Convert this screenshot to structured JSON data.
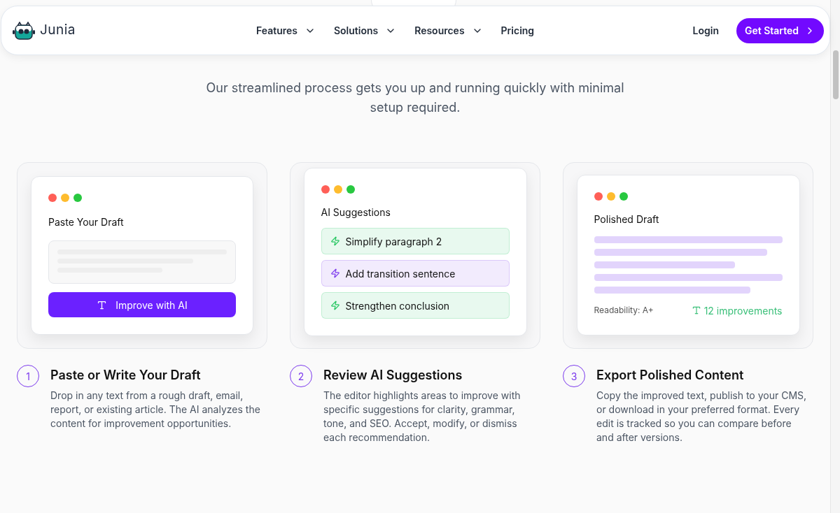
{
  "nav": {
    "brand": "Junia",
    "links": [
      {
        "label": "Features",
        "dropdown": true
      },
      {
        "label": "Solutions",
        "dropdown": true
      },
      {
        "label": "Resources",
        "dropdown": true
      },
      {
        "label": "Pricing",
        "dropdown": false
      }
    ],
    "login": "Login",
    "cta": "Get Started"
  },
  "hero": {
    "subtitle": "Our streamlined process gets you up and running quickly with minimal setup required."
  },
  "steps": [
    {
      "kind": "draft",
      "number": "1",
      "title": "Paste or Write Your Draft",
      "description": "Drop in any text from a rough draft, email, report, or existing article. The AI analyzes the content for improvement opportunities.",
      "mockup": {
        "title": "Paste Your Draft",
        "button": "Improve with AI"
      }
    },
    {
      "kind": "suggestions",
      "number": "2",
      "title": "Review AI Suggestions",
      "description": "The editor highlights areas to improve with specific suggestions for clarity, grammar, tone, and SEO. Accept, modify, or dismiss each recommendation.",
      "mockup": {
        "title": "AI Suggestions",
        "suggestions": [
          {
            "label": "Simplify paragraph 2",
            "color": "#22c55e"
          },
          {
            "label": "Add transition sentence",
            "color": "#7c3aed"
          },
          {
            "label": "Strengthen conclusion",
            "color": "#22c55e"
          }
        ]
      }
    },
    {
      "kind": "polished",
      "number": "3",
      "title": "Export Polished Content",
      "description": "Copy the improved text, publish to your CMS, or download in your preferred format. Every edit is tracked so you can compare before and after versions.",
      "mockup": {
        "title": "Polished Draft",
        "readability": "Readability: A+",
        "improvements": "12 improvements"
      }
    }
  ]
}
